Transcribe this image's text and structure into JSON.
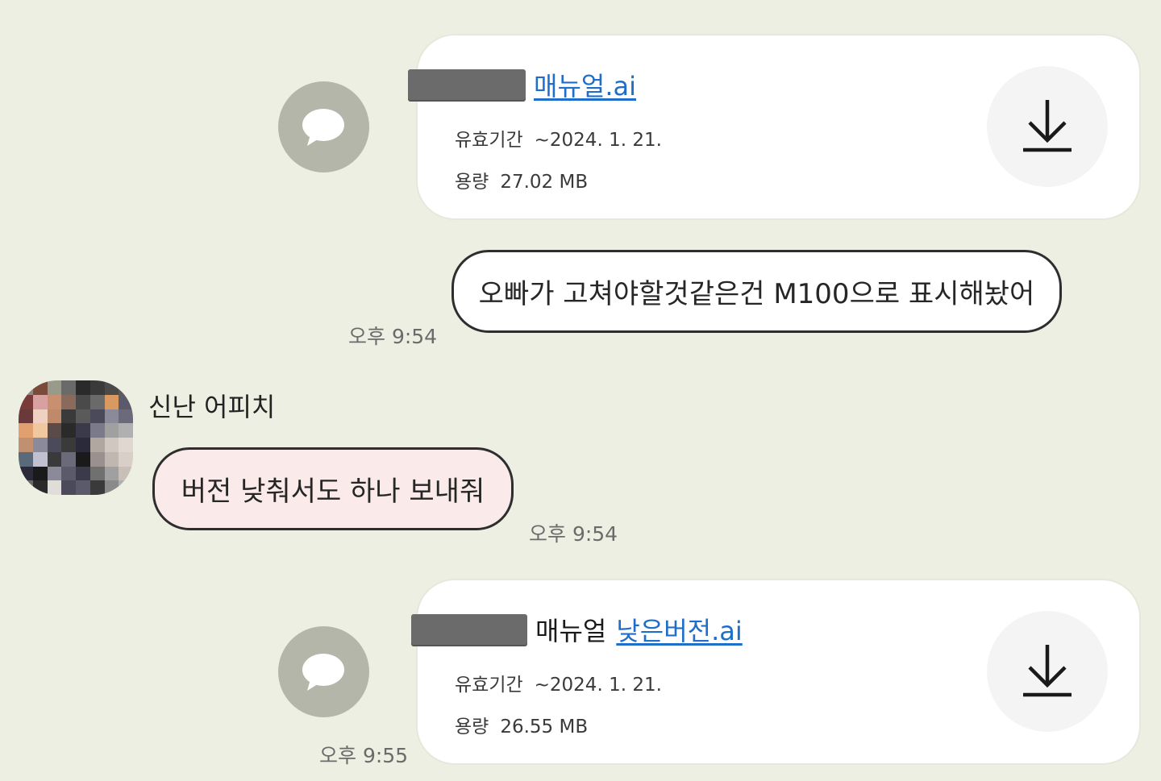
{
  "messages": [
    {
      "type": "file",
      "file_name": "매뉴얼.ai",
      "expiry_label": "유효기간",
      "expiry_value": "~2024. 1. 21.",
      "size_label": "용량",
      "size_value": "27.02 MB"
    },
    {
      "type": "text",
      "text": "오빠가 고쳐야할것같은건 M100으로 표시해놨어",
      "time": "오후 9:54"
    },
    {
      "type": "text",
      "sender": "신난 어피치",
      "text": "버전 낮춰서도 하나 보내줘",
      "time": "오후 9:54"
    },
    {
      "type": "file",
      "file_name_prefix": "매뉴얼",
      "file_name": "낮은버전.ai",
      "expiry_label": "유효기간",
      "expiry_value": "~2024. 1. 21.",
      "size_label": "용량",
      "size_value": "26.55 MB",
      "time": "오후 9:55"
    }
  ],
  "icons": {
    "talk": "speech-bubble-icon",
    "download": "download-icon"
  },
  "colors": {
    "background": "#edefe2",
    "link": "#1f6ec9",
    "incoming_bubble": "#fbeaea",
    "icon_circle": "#b4b6a9"
  }
}
